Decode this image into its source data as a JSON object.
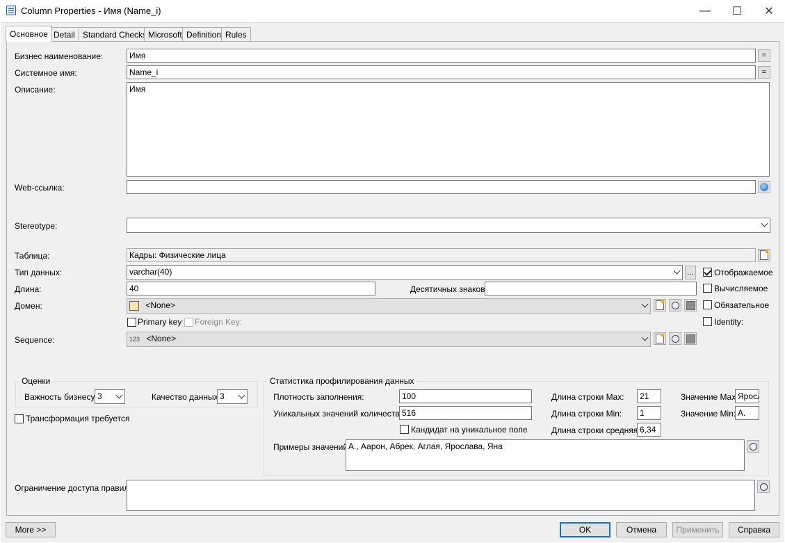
{
  "window": {
    "title": "Column Properties - Имя (Name_i)",
    "minimize": "—",
    "maximize": "☐",
    "close": "✕"
  },
  "tabs": [
    {
      "label": "Основное",
      "active": true
    },
    {
      "label": "Detail"
    },
    {
      "label": "Standard Checks"
    },
    {
      "label": "Microsoft"
    },
    {
      "label": "Definition"
    },
    {
      "label": "Rules"
    }
  ],
  "form": {
    "business_name_label": "Бизнес наименование:",
    "business_name_value": "Имя",
    "system_name_label": "Системное имя:",
    "system_name_value": "Name_i",
    "eq_button": "=",
    "description_label": "Описание:",
    "description_value": "Имя",
    "web_label": "Web-ссылка:",
    "web_value": "",
    "stereotype_label": "Stereotype:",
    "stereotype_value": "",
    "table_label": "Таблица:",
    "table_value": "Кадры: Физические лица",
    "datatype_label": "Тип данных:",
    "datatype_value": "varchar(40)",
    "ellipsis": "...",
    "length_label": "Длина:",
    "length_value": "40",
    "decimals_label": "Десятичных знаков:",
    "decimals_value": "",
    "domain_label": "Домен:",
    "domain_value": "<None>",
    "primary_key_label": "Primary key",
    "foreign_key_label": "Foreign Key:",
    "sequence_label": "Sequence:",
    "sequence_value": "<None>",
    "sequence_icon_text": "123",
    "displayed_label": "Отображаемое",
    "computed_label": "Вычисляемое",
    "mandatory_label": "Обязательное",
    "identity_label": "Identity:"
  },
  "ratings": {
    "title": "Оценки",
    "business_importance_label": "Важность бизнесу:",
    "business_importance_value": "3",
    "data_quality_label": "Качество данных:",
    "data_quality_value": "3",
    "transform_label": "Трансформация требуется"
  },
  "stats": {
    "title": "Статистика профилирования данных",
    "density_label": "Плотность заполнения:",
    "density_value": "100",
    "unique_label": "Уникальных значений количество:",
    "unique_value": "516",
    "unique_candidate_label": "Кандидат на уникальное поле",
    "max_len_label": "Длина строки Max:",
    "max_len_value": "21",
    "min_len_label": "Длина строки Min:",
    "min_len_value": "1",
    "avg_len_label": "Длина строки средняя:",
    "avg_len_value": "6,34",
    "max_val_label": "Значение Max:",
    "max_val_value": "Ярослава",
    "min_val_label": "Значение Min:",
    "min_val_value": "А.",
    "examples_label": "Примеры значений:",
    "examples_value": "А., Аарон, Абрек, Аглая, Ярослава, Яна"
  },
  "access": {
    "label": "Ограничение доступа правило:",
    "value": ""
  },
  "buttons": {
    "more": "More >>",
    "ok": "OK",
    "cancel": "Отмена",
    "apply": "Применить",
    "help": "Справка"
  }
}
